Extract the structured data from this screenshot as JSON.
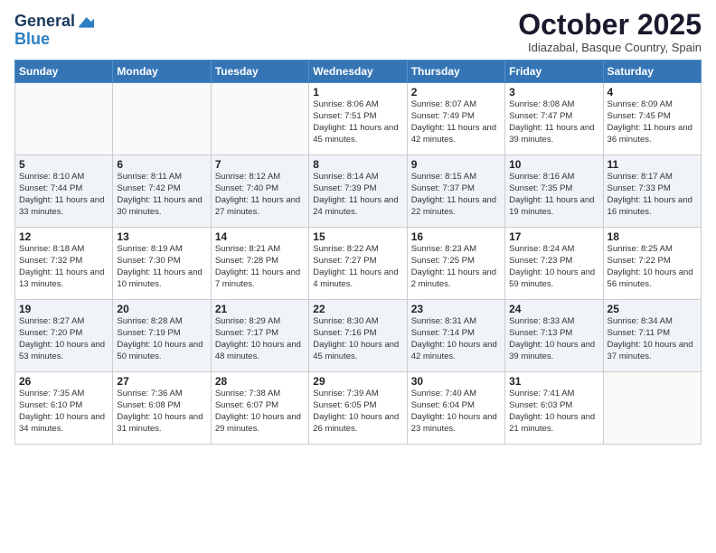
{
  "header": {
    "logo_line1": "General",
    "logo_line2": "Blue",
    "month": "October 2025",
    "location": "Idiazabal, Basque Country, Spain"
  },
  "weekdays": [
    "Sunday",
    "Monday",
    "Tuesday",
    "Wednesday",
    "Thursday",
    "Friday",
    "Saturday"
  ],
  "weeks": [
    [
      null,
      null,
      null,
      {
        "day": 1,
        "sunrise": "8:06 AM",
        "sunset": "7:51 PM",
        "daylight": "11 hours and 45 minutes."
      },
      {
        "day": 2,
        "sunrise": "8:07 AM",
        "sunset": "7:49 PM",
        "daylight": "11 hours and 42 minutes."
      },
      {
        "day": 3,
        "sunrise": "8:08 AM",
        "sunset": "7:47 PM",
        "daylight": "11 hours and 39 minutes."
      },
      {
        "day": 4,
        "sunrise": "8:09 AM",
        "sunset": "7:45 PM",
        "daylight": "11 hours and 36 minutes."
      }
    ],
    [
      {
        "day": 5,
        "sunrise": "8:10 AM",
        "sunset": "7:44 PM",
        "daylight": "11 hours and 33 minutes."
      },
      {
        "day": 6,
        "sunrise": "8:11 AM",
        "sunset": "7:42 PM",
        "daylight": "11 hours and 30 minutes."
      },
      {
        "day": 7,
        "sunrise": "8:12 AM",
        "sunset": "7:40 PM",
        "daylight": "11 hours and 27 minutes."
      },
      {
        "day": 8,
        "sunrise": "8:14 AM",
        "sunset": "7:39 PM",
        "daylight": "11 hours and 24 minutes."
      },
      {
        "day": 9,
        "sunrise": "8:15 AM",
        "sunset": "7:37 PM",
        "daylight": "11 hours and 22 minutes."
      },
      {
        "day": 10,
        "sunrise": "8:16 AM",
        "sunset": "7:35 PM",
        "daylight": "11 hours and 19 minutes."
      },
      {
        "day": 11,
        "sunrise": "8:17 AM",
        "sunset": "7:33 PM",
        "daylight": "11 hours and 16 minutes."
      }
    ],
    [
      {
        "day": 12,
        "sunrise": "8:18 AM",
        "sunset": "7:32 PM",
        "daylight": "11 hours and 13 minutes."
      },
      {
        "day": 13,
        "sunrise": "8:19 AM",
        "sunset": "7:30 PM",
        "daylight": "11 hours and 10 minutes."
      },
      {
        "day": 14,
        "sunrise": "8:21 AM",
        "sunset": "7:28 PM",
        "daylight": "11 hours and 7 minutes."
      },
      {
        "day": 15,
        "sunrise": "8:22 AM",
        "sunset": "7:27 PM",
        "daylight": "11 hours and 4 minutes."
      },
      {
        "day": 16,
        "sunrise": "8:23 AM",
        "sunset": "7:25 PM",
        "daylight": "11 hours and 2 minutes."
      },
      {
        "day": 17,
        "sunrise": "8:24 AM",
        "sunset": "7:23 PM",
        "daylight": "10 hours and 59 minutes."
      },
      {
        "day": 18,
        "sunrise": "8:25 AM",
        "sunset": "7:22 PM",
        "daylight": "10 hours and 56 minutes."
      }
    ],
    [
      {
        "day": 19,
        "sunrise": "8:27 AM",
        "sunset": "7:20 PM",
        "daylight": "10 hours and 53 minutes."
      },
      {
        "day": 20,
        "sunrise": "8:28 AM",
        "sunset": "7:19 PM",
        "daylight": "10 hours and 50 minutes."
      },
      {
        "day": 21,
        "sunrise": "8:29 AM",
        "sunset": "7:17 PM",
        "daylight": "10 hours and 48 minutes."
      },
      {
        "day": 22,
        "sunrise": "8:30 AM",
        "sunset": "7:16 PM",
        "daylight": "10 hours and 45 minutes."
      },
      {
        "day": 23,
        "sunrise": "8:31 AM",
        "sunset": "7:14 PM",
        "daylight": "10 hours and 42 minutes."
      },
      {
        "day": 24,
        "sunrise": "8:33 AM",
        "sunset": "7:13 PM",
        "daylight": "10 hours and 39 minutes."
      },
      {
        "day": 25,
        "sunrise": "8:34 AM",
        "sunset": "7:11 PM",
        "daylight": "10 hours and 37 minutes."
      }
    ],
    [
      {
        "day": 26,
        "sunrise": "7:35 AM",
        "sunset": "6:10 PM",
        "daylight": "10 hours and 34 minutes."
      },
      {
        "day": 27,
        "sunrise": "7:36 AM",
        "sunset": "6:08 PM",
        "daylight": "10 hours and 31 minutes."
      },
      {
        "day": 28,
        "sunrise": "7:38 AM",
        "sunset": "6:07 PM",
        "daylight": "10 hours and 29 minutes."
      },
      {
        "day": 29,
        "sunrise": "7:39 AM",
        "sunset": "6:05 PM",
        "daylight": "10 hours and 26 minutes."
      },
      {
        "day": 30,
        "sunrise": "7:40 AM",
        "sunset": "6:04 PM",
        "daylight": "10 hours and 23 minutes."
      },
      {
        "day": 31,
        "sunrise": "7:41 AM",
        "sunset": "6:03 PM",
        "daylight": "10 hours and 21 minutes."
      },
      null
    ]
  ]
}
